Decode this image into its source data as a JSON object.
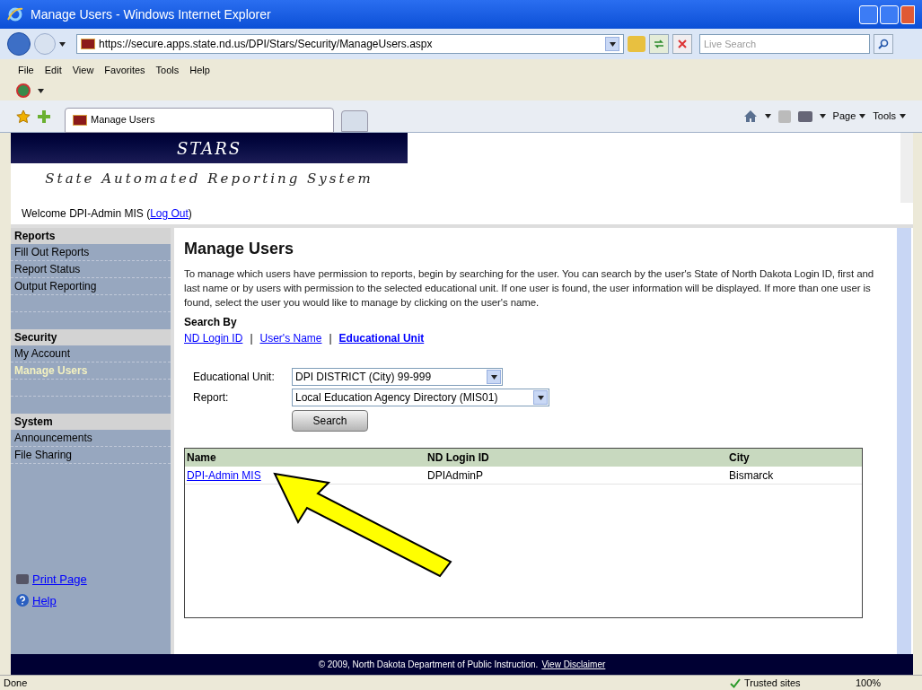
{
  "window": {
    "title": "Manage Users - Windows Internet Explorer"
  },
  "address": {
    "url": "https://secure.apps.state.nd.us/DPI/Stars/Security/ManageUsers.aspx"
  },
  "search": {
    "placeholder": "Live Search"
  },
  "menu": [
    "File",
    "Edit",
    "View",
    "Favorites",
    "Tools",
    "Help"
  ],
  "tabs": [
    {
      "title": "Manage Users",
      "selected": true
    }
  ],
  "commands": [
    "Page",
    "Tools"
  ],
  "header": {
    "logo": "STARS",
    "subtitle": "State Automated Reporting System"
  },
  "welcome": {
    "text": "Welcome DPI-Admin MIS (",
    "link": "Log Out",
    "suffix": ")"
  },
  "sidebar": {
    "sections": [
      {
        "title": "Reports",
        "items": [
          {
            "label": "Fill Out Reports",
            "selected": false
          },
          {
            "label": "Report Status",
            "selected": false
          },
          {
            "label": "Output Reporting",
            "selected": false
          }
        ]
      },
      {
        "title": "Security",
        "items": [
          {
            "label": "My Account",
            "selected": false
          },
          {
            "label": "Manage Users",
            "selected": true
          }
        ]
      },
      {
        "title": "System",
        "items": [
          {
            "label": "Announcements",
            "selected": false
          },
          {
            "label": "File Sharing",
            "selected": false
          }
        ]
      }
    ],
    "links": [
      {
        "kind": "print",
        "label": "Print Page"
      },
      {
        "kind": "help",
        "label": "Help"
      }
    ]
  },
  "main": {
    "heading": "Manage Users",
    "description": "To manage which users have permission to reports, begin by searching for the user. You can search by the user's State of North Dakota Login ID, first and last name or by users with permission to the selected educational unit. If one user is found, the user information will be displayed. If more than one user is found, select the user you would like to manage by clicking on the user's name.",
    "search_by": "Search By",
    "search_links": [
      {
        "label": "ND Login ID",
        "selected": false
      },
      {
        "label": "User's Name",
        "selected": false
      },
      {
        "label": "Educational Unit",
        "selected": true
      }
    ],
    "separator": "|",
    "fields": [
      {
        "label": "Educational Unit:",
        "value": "DPI DISTRICT (City) 99-999"
      },
      {
        "label": "Report:",
        "value": "Local Education Agency Directory (MIS01)"
      }
    ],
    "button": "Search",
    "table": {
      "columns": [
        "Name",
        "ND Login ID",
        "City"
      ],
      "rows": [
        [
          "DPI-Admin MIS",
          "DPIAdminP",
          "Bismarck"
        ]
      ]
    }
  },
  "footer": {
    "text": "© 2009, North Dakota Department of Public Instruction.",
    "link": "View Disclaimer"
  },
  "status_bar": {
    "status": "Done",
    "zone": "Trusted sites",
    "zoom": "100%"
  }
}
